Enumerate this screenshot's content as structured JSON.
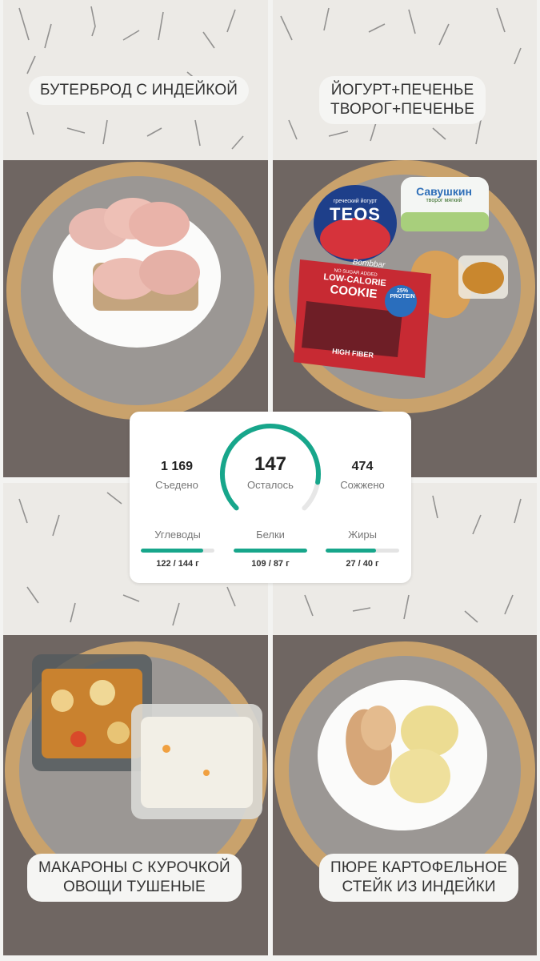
{
  "meals": [
    {
      "label_lines": [
        "БУТЕРБРОД С ИНДЕЙКОЙ"
      ]
    },
    {
      "label_lines": [
        "ЙОГУРТ+ПЕЧЕНЬЕ",
        "ТВОРОГ+ПЕЧЕНЬЕ"
      ]
    },
    {
      "label_lines": [
        "МАКАРОНЫ С КУРОЧКОЙ",
        "ОВОЩИ ТУШЕНЫЕ"
      ]
    },
    {
      "label_lines": [
        "ПЮРЕ КАРТОФЕЛЬНОЕ",
        "СТЕЙК ИЗ ИНДЕЙКИ"
      ]
    }
  ],
  "packaging": {
    "yogurt_brand": "TEOS",
    "yogurt_caption": "греческий йогурт",
    "cottage_brand": "Савушкин",
    "cottage_caption": "творог мягкий",
    "cookie_line1": "NO SUGAR ADDED",
    "cookie_line2": "LOW-CALORIE",
    "cookie_line3": "COOKIE",
    "cookie_line4": "HIGH FIBER",
    "cookie_badge": "25% PROTEIN",
    "cookie_brand": "Bombbar"
  },
  "summary": {
    "eaten_value": "1 169",
    "eaten_label": "Съедено",
    "remaining_value": "147",
    "remaining_label": "Осталось",
    "remaining_fraction": 0.87,
    "burned_value": "474",
    "burned_label": "Сожжено",
    "accent_color": "#17a68b"
  },
  "macros": [
    {
      "name": "Углеводы",
      "value": "122 / 144 г",
      "fraction": 0.85
    },
    {
      "name": "Белки",
      "value": "109 / 87 г",
      "fraction": 1.0
    },
    {
      "name": "Жиры",
      "value": "27 / 40 г",
      "fraction": 0.68
    }
  ]
}
